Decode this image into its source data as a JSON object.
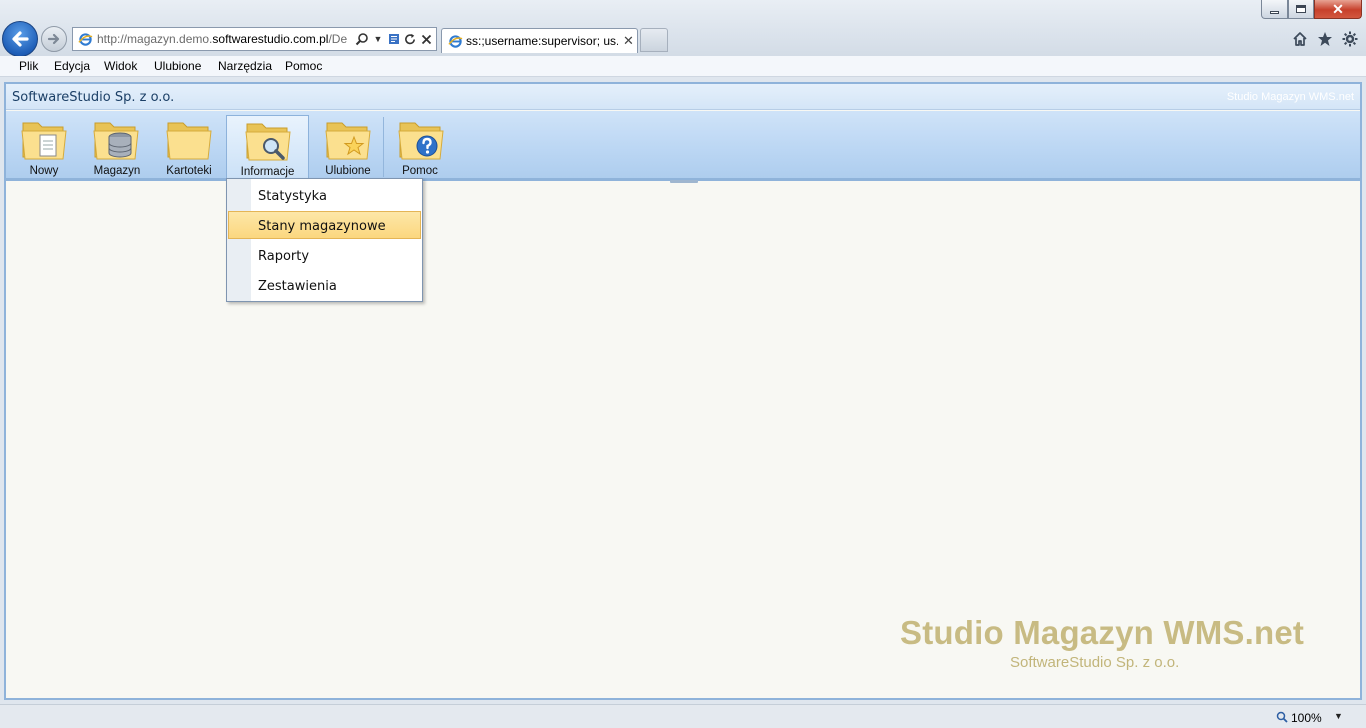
{
  "browser": {
    "window_controls": {
      "close": "✕"
    },
    "address_url_prefix": "http://magazyn.demo.",
    "address_url_host": "softwarestudio.com.pl",
    "address_url_suffix": "/De",
    "tab_title": "ss:;username:supervisor; us...",
    "tab_close": "✕"
  },
  "menu": {
    "items": [
      "Plik",
      "Edycja",
      "Widok",
      "Ulubione",
      "Narzędzia",
      "Pomoc"
    ]
  },
  "app": {
    "company": "SoftwareStudio Sp. z o.o.",
    "product": "Studio Magazyn WMS.net",
    "ribbon": [
      {
        "label": "Nowy",
        "icon": "new-document-folder-icon"
      },
      {
        "label": "Magazyn",
        "icon": "database-folder-icon"
      },
      {
        "label": "Kartoteki",
        "icon": "folder-icon"
      },
      {
        "label": "Informacje",
        "icon": "magnifier-folder-icon",
        "active": true
      },
      {
        "label": "Ulubione",
        "icon": "star-folder-icon"
      },
      {
        "label": "Pomoc",
        "icon": "help-folder-icon"
      }
    ],
    "dropdown": {
      "items": [
        "Statystyka",
        "Stany magazynowe",
        "Raporty",
        "Zestawienia"
      ],
      "highlighted": "Stany magazynowe"
    },
    "watermark": {
      "title": "Studio Magazyn WMS.net",
      "subtitle": "SoftwareStudio Sp. z o.o."
    }
  },
  "status": {
    "zoom": "100%"
  },
  "colors": {
    "accent": "#8fb3da",
    "ribbon": "#bcd7f4",
    "highlight": "#fbd77f",
    "watermark": "#c8bb83"
  }
}
